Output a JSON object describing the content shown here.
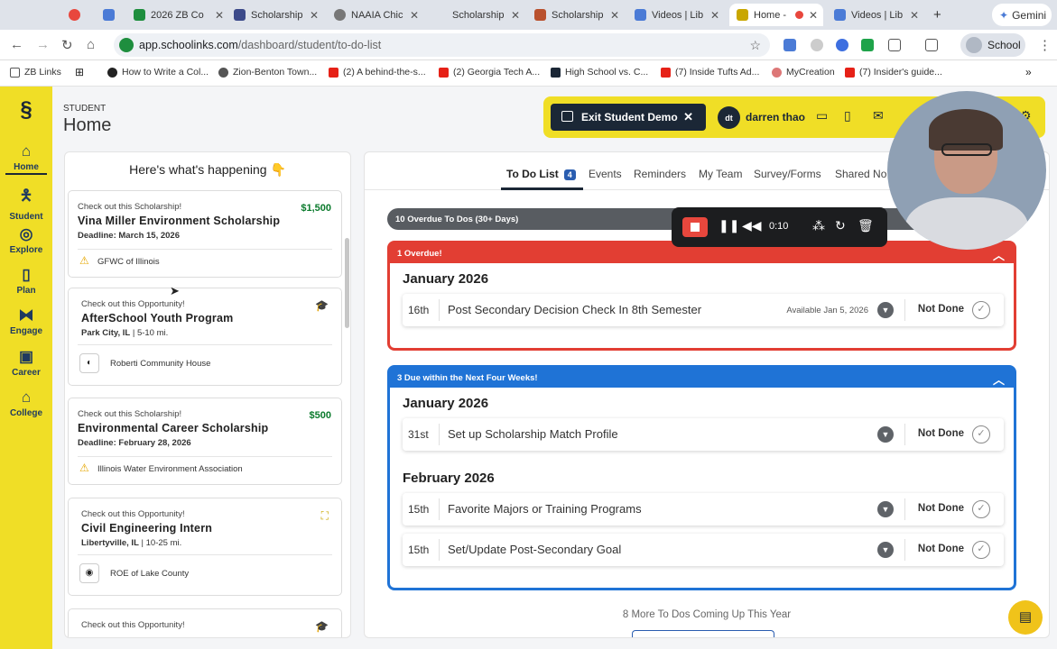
{
  "browser": {
    "tabs": [
      {
        "label": "",
        "color": "#e8473d"
      },
      {
        "label": "",
        "color": "#4b7bd6"
      },
      {
        "label": "2026 ZB Co",
        "color": "#1e8e3e"
      },
      {
        "label": "Scholarship",
        "color": "#3c4a8a"
      },
      {
        "label": "NAAIA Chic",
        "color": "#777777"
      },
      {
        "label": "Scholarship",
        "color": "#ffffff"
      },
      {
        "label": "Scholarship",
        "color": "#b9512e"
      },
      {
        "label": "Videos | Lib",
        "color": "#4b7bd6"
      },
      {
        "label": "Home -",
        "color": "#c9a700"
      },
      {
        "label": "Videos | Lib",
        "color": "#4b7bd6"
      }
    ],
    "new_tab": "+",
    "gemini_label": "Gemini",
    "url_host": "app.schoolinks.com",
    "url_path": "/dashboard/student/to-do-list",
    "profile_label": "School",
    "bookmarks": [
      "ZB Links",
      "How to Write a Col...",
      "Zion-Benton Town...",
      "(2) A behind-the-s...",
      "(2) Georgia Tech A...",
      "High School vs. C...",
      "(7) Inside Tufts Ad...",
      "MyCreation",
      "(7) Insider's guide..."
    ]
  },
  "rail": {
    "items": [
      "Home",
      "Student",
      "Explore",
      "Plan",
      "Engage",
      "Career",
      "College"
    ]
  },
  "header": {
    "section": "STUDENT",
    "title": "Home",
    "exit_demo": "Exit Student Demo",
    "user_initials": "dt",
    "user_name": "darren thao"
  },
  "feed": {
    "title": "Here's what's happening 👇",
    "cards": [
      {
        "kicker": "Check out this Scholarship!",
        "title": "Vina Miller Environment Scholarship",
        "sub_bold": "Deadline: March 15, 2026",
        "sub_light": "",
        "amount": "$1,500",
        "org": "GFWC of Illinois"
      },
      {
        "kicker": "Check out this Opportunity!",
        "title": "AfterSchool Youth Program",
        "sub_bold": "Park City, IL",
        "sub_light": " | 5-10 mi.",
        "amount": "",
        "org": "Roberti Community House"
      },
      {
        "kicker": "Check out this Scholarship!",
        "title": "Environmental Career Scholarship",
        "sub_bold": "Deadline: February 28, 2026",
        "sub_light": "",
        "amount": "$500",
        "org": "Illinois Water Environment Association"
      },
      {
        "kicker": "Check out this Opportunity!",
        "title": "Civil Engineering Intern",
        "sub_bold": "Libertyville, IL",
        "sub_light": " | 10-25 mi.",
        "amount": "",
        "org": "ROE of Lake County"
      },
      {
        "kicker": "Check out this Opportunity!",
        "title": "",
        "sub_bold": "",
        "sub_light": "",
        "amount": "",
        "org": ""
      }
    ]
  },
  "todo": {
    "tabs": {
      "todo": "To Do List",
      "todo_count": "4",
      "events": "Events",
      "reminders": "Reminders",
      "team": "My Team",
      "survey": "Survey/Forms",
      "shared": "Shared No"
    },
    "overdue_30": "10 Overdue To Dos (30+ Days)",
    "overdue_header": "1 Overdue!",
    "overdue_color": "#e23e33",
    "overdue_month": "January 2026",
    "overdue_rows": [
      {
        "day": "16th",
        "task": "Post Secondary Decision Check In 8th Semester",
        "avail": "Available Jan 5, 2026",
        "status": "Not Done"
      }
    ],
    "due_header": "3 Due within the Next Four Weeks!",
    "due_color": "#1f73d6",
    "due_month_1": "January 2026",
    "due_rows_1": [
      {
        "day": "31st",
        "task": "Set up Scholarship Match Profile",
        "avail": "",
        "status": "Not Done"
      }
    ],
    "due_month_2": "February 2026",
    "due_rows_2": [
      {
        "day": "15th",
        "task": "Favorite Majors or Training Programs",
        "avail": "",
        "status": "Not Done"
      },
      {
        "day": "15th",
        "task": "Set/Update Post-Secondary Goal",
        "avail": "",
        "status": "Not Done"
      }
    ],
    "more_text": "8 More To Dos Coming Up This Year"
  },
  "recorder": {
    "time": "0:10"
  },
  "colors": {
    "brand_yellow": "#f0de26",
    "navy": "#1b2736",
    "green_amount": "#0a7a2c"
  }
}
